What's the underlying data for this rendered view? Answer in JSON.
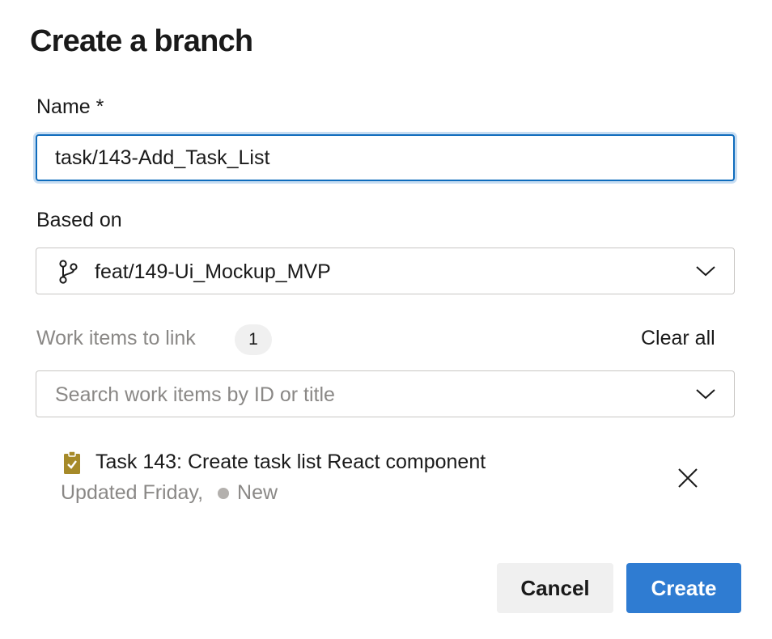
{
  "dialog": {
    "title": "Create a branch"
  },
  "name_field": {
    "label": "Name *",
    "value": "task/143-Add_Task_List"
  },
  "based_on": {
    "label": "Based on",
    "icon": "branch-icon",
    "selected": "feat/149-Ui_Mockup_MVP"
  },
  "work_items": {
    "label": "Work items to link",
    "count": "1",
    "clear_all": "Clear all",
    "search_placeholder": "Search work items by ID or title",
    "items": [
      {
        "icon": "task-clipboard-icon",
        "title": "Task 143: Create task list React component",
        "updated": "Updated Friday,",
        "status": "New"
      }
    ]
  },
  "footer": {
    "cancel_label": "Cancel",
    "create_label": "Create"
  },
  "colors": {
    "primary": "#2f7cd2",
    "focus_border": "#0f6cbd",
    "task_icon": "#a68a29",
    "status_new": "#b3b0ad"
  }
}
